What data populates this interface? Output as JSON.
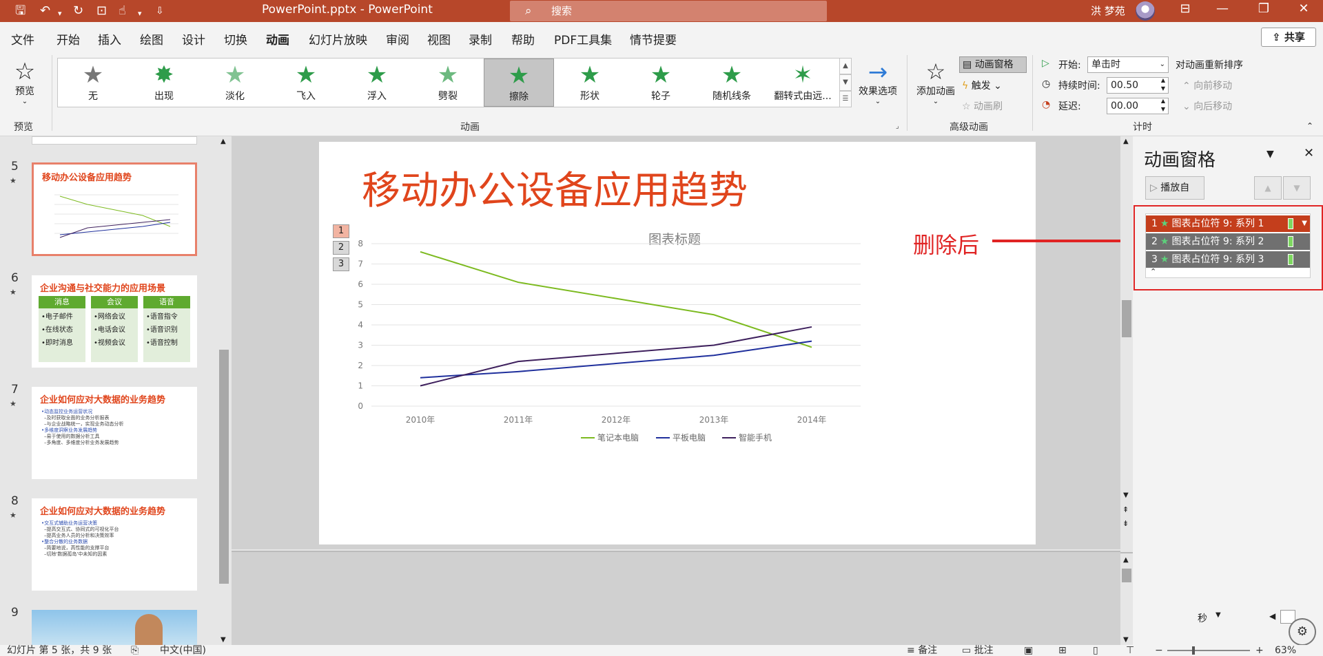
{
  "titlebar": {
    "doc_title": "PowerPoint.pptx  -  PowerPoint",
    "search_placeholder": "搜索",
    "user_name": "洪 梦苑"
  },
  "menu": [
    "文件",
    "开始",
    "插入",
    "绘图",
    "设计",
    "切换",
    "动画",
    "幻灯片放映",
    "审阅",
    "视图",
    "录制",
    "帮助",
    "PDF工具集",
    "情节提要"
  ],
  "menu_active": "动画",
  "share_label": "共享",
  "ribbon": {
    "preview_label": "预览",
    "preview_group": "预览",
    "animations": [
      "无",
      "出现",
      "淡化",
      "飞入",
      "浮入",
      "劈裂",
      "擦除",
      "形状",
      "轮子",
      "随机线条",
      "翻转式由远..."
    ],
    "selected_animation": "擦除",
    "effect_options": "效果选项",
    "animation_group": "动画",
    "add_animation": "添加动画",
    "anim_pane": "动画窗格",
    "trigger": "触发",
    "anim_painter": "动画刷",
    "advanced_group": "高级动画",
    "start_label": "开始:",
    "start_value": "单击时",
    "duration_label": "持续时间:",
    "duration_value": "00.50",
    "delay_label": "延迟:",
    "delay_value": "00.00",
    "reorder_label": "对动画重新排序",
    "move_earlier": "向前移动",
    "move_later": "向后移动",
    "timing_group": "计时"
  },
  "thumbnails": [
    {
      "num": "5",
      "title": "移动办公设备应用趋势"
    },
    {
      "num": "6",
      "title": "企业沟通与社交能力的应用场景",
      "cols": [
        "消息",
        "会议",
        "语音"
      ],
      "rows": [
        [
          "•电子邮件",
          "•在线状态",
          "•即时消息"
        ],
        [
          "•网络会议",
          "•电话会议",
          "•视频会议"
        ],
        [
          "•语音指令",
          "•语音识别",
          "•语音控制"
        ]
      ]
    },
    {
      "num": "7",
      "title": "企业如何应对大数据的业务趋势",
      "lines": [
        "•动态监控业务运营状况",
        "–及时获取全面的业务分析报表",
        "–与企业战略统一，实现业务动态分析",
        "•多维度洞察业务发展趋势",
        "–易于使用的数据分析工具",
        "–多角度、多维度分析业务发展趋势"
      ]
    },
    {
      "num": "8",
      "title": "企业如何应对大数据的业务趋势",
      "lines": [
        "•交互式辅助业务运营决策",
        "–提高交互式、协同式的可视化平台",
        "–提高业务人员的分析和决策效率",
        "•整合分散的业务数据",
        "–简要地说，高性能的支撑平台",
        "–切除'数据孤岛'中未知的因素"
      ]
    },
    {
      "num": "9"
    }
  ],
  "slide": {
    "title": "移动办公设备应用趋势",
    "anim_tags": [
      "1",
      "2",
      "3"
    ],
    "annotation": "删除后"
  },
  "chart_data": {
    "type": "line",
    "title": "图表标题",
    "categories": [
      "2010年",
      "2011年",
      "2012年",
      "2013年",
      "2014年"
    ],
    "series": [
      {
        "name": "笔记本电脑",
        "color": "#7cba1f",
        "values": [
          7.6,
          6.1,
          5.3,
          4.5,
          2.9
        ]
      },
      {
        "name": "平板电脑",
        "color": "#1f2f9c",
        "values": [
          1.4,
          1.7,
          2.1,
          2.5,
          3.2
        ]
      },
      {
        "name": "智能手机",
        "color": "#3d1f5c",
        "values": [
          1.0,
          2.2,
          2.6,
          3.0,
          3.9
        ]
      }
    ],
    "ylim": [
      0,
      8
    ],
    "yticks": [
      0,
      1,
      2,
      3,
      4,
      5,
      6,
      7,
      8
    ],
    "grid": true,
    "legend": "bottom"
  },
  "anim_pane": {
    "title": "动画窗格",
    "play_from": "播放自",
    "items": [
      {
        "num": "1",
        "label": "图表占位符 9: 系列 1"
      },
      {
        "num": "2",
        "label": "图表占位符 9: 系列 2"
      },
      {
        "num": "3",
        "label": "图表占位符 9: 系列 3"
      }
    ],
    "seconds": "秒"
  },
  "status": {
    "slide_info": "幻灯片 第 5 张，共 9 张",
    "language": "中文(中国)",
    "notes": "备注",
    "comments": "批注",
    "zoom": "63%"
  }
}
